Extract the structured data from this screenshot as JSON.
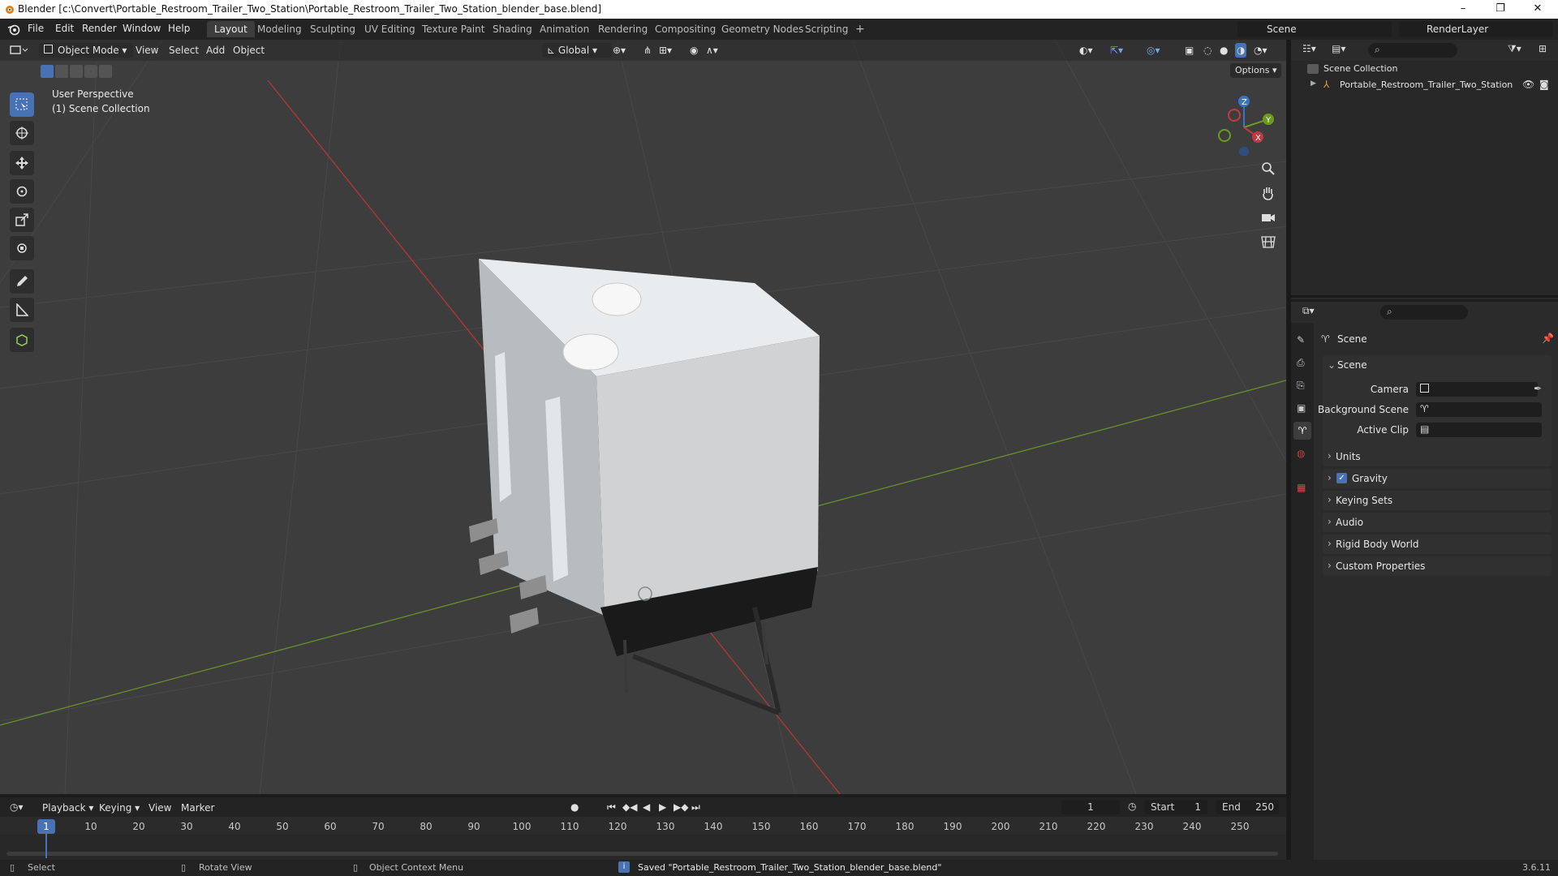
{
  "window": {
    "title": "Blender [c:\\Convert\\Portable_Restroom_Trailer_Two_Station\\Portable_Restroom_Trailer_Two_Station_blender_base.blend]",
    "minimize": "–",
    "maximize": "❐",
    "close": "✕"
  },
  "menu": {
    "items": [
      "File",
      "Edit",
      "Render",
      "Window",
      "Help"
    ]
  },
  "workspaces": {
    "tabs": [
      "Layout",
      "Modeling",
      "Sculpting",
      "UV Editing",
      "Texture Paint",
      "Shading",
      "Animation",
      "Rendering",
      "Compositing",
      "Geometry Nodes",
      "Scripting"
    ],
    "active": "Layout",
    "add": "+"
  },
  "top_right": {
    "scene": "Scene",
    "view_layer": "RenderLayer"
  },
  "viewport": {
    "mode": "Object Mode",
    "menus": [
      "View",
      "Select",
      "Add",
      "Object"
    ],
    "orientation": "Global",
    "options": "Options",
    "overlay_line1": "User Perspective",
    "overlay_line2": "(1) Scene Collection",
    "gizmo": {
      "x": "X",
      "y": "Y",
      "z": "Z"
    }
  },
  "outliner": {
    "root": "Scene Collection",
    "object": "Portable_Restroom_Trailer_Two_Station"
  },
  "properties": {
    "header": "Scene",
    "panel": "Scene",
    "fields": [
      {
        "label": "Camera"
      },
      {
        "label": "Background Scene"
      },
      {
        "label": "Active Clip"
      }
    ],
    "sections": [
      "Units",
      "Gravity",
      "Keying Sets",
      "Audio",
      "Rigid Body World",
      "Custom Properties"
    ],
    "gravity_checked": true
  },
  "timeline": {
    "menus": [
      "Playback",
      "Keying",
      "View",
      "Marker"
    ],
    "current_frame": "1",
    "start_label": "Start",
    "start": "1",
    "end_label": "End",
    "end": "250",
    "ticks": [
      "1",
      "10",
      "20",
      "30",
      "40",
      "50",
      "60",
      "70",
      "80",
      "90",
      "100",
      "110",
      "120",
      "130",
      "140",
      "150",
      "160",
      "170",
      "180",
      "190",
      "200",
      "210",
      "220",
      "230",
      "240",
      "250"
    ]
  },
  "status": {
    "select": "Select",
    "rotate": "Rotate View",
    "context": "Object Context Menu",
    "message": "Saved \"Portable_Restroom_Trailer_Two_Station_blender_base.blend\"",
    "version": "3.6.11"
  },
  "colors": {
    "accent": "#4772b3",
    "x_axis": "#c6383f",
    "y_axis": "#6c9a1f",
    "z_axis": "#3c73c4"
  }
}
